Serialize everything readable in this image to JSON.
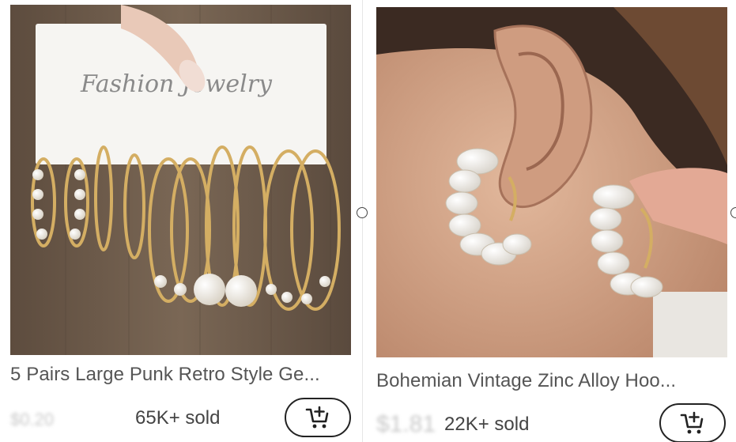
{
  "products": [
    {
      "title": "5 Pairs Large Punk Retro Style Ge...",
      "price": "$0.20",
      "sold": "65K+ sold",
      "image": {
        "card_text": "Fashion Jewelry"
      },
      "cart_icon": "add-to-cart-icon"
    },
    {
      "title": "Bohemian Vintage Zinc Alloy Hoo...",
      "price": "$1.81",
      "sold": "22K+ sold",
      "image": {
        "card_text": ""
      },
      "cart_icon": "add-to-cart-icon"
    }
  ],
  "colors": {
    "title": "#555555",
    "sold": "#444444",
    "button_border": "#222222",
    "background": "#ffffff"
  }
}
